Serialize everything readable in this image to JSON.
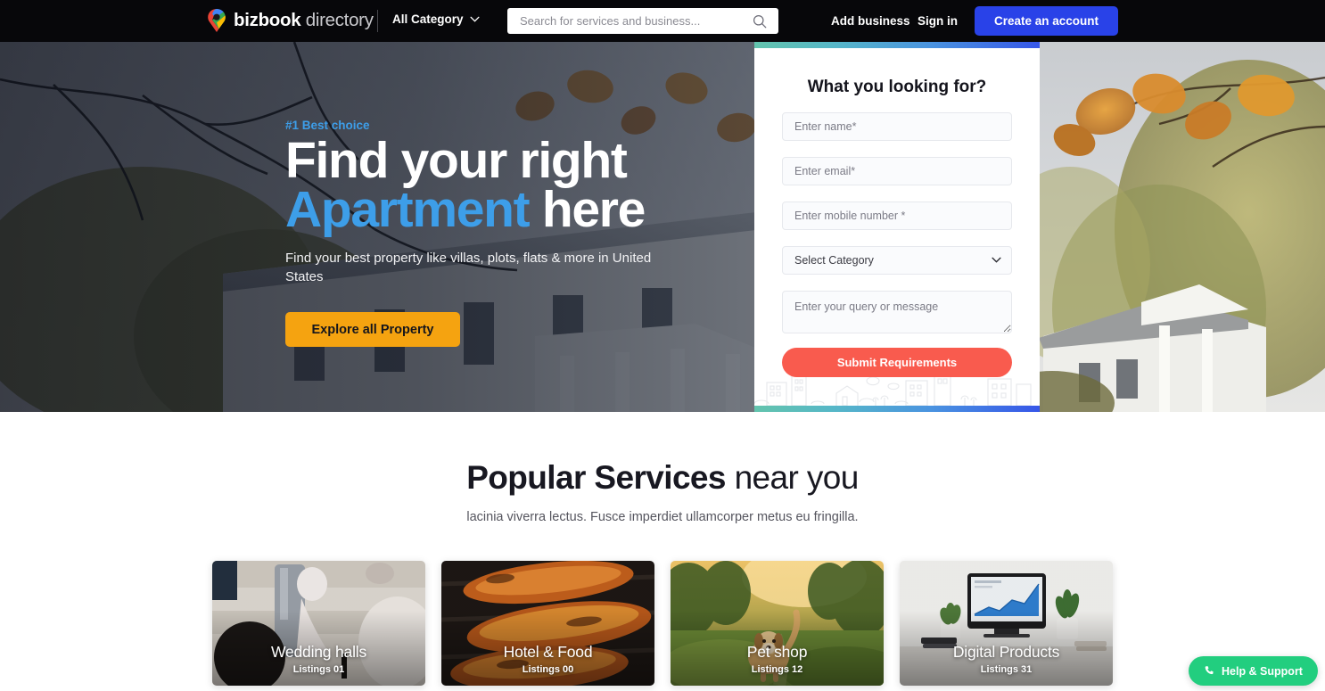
{
  "header": {
    "logo": {
      "brand": "bizbook",
      "suffix": "directory",
      "icon": "map-pin-icon"
    },
    "category_label": "All Category",
    "search": {
      "placeholder": "Search for services and business...",
      "value": "",
      "icon": "search-icon"
    },
    "add_business": "Add business",
    "sign_in": "Sign in",
    "create_account": "Create an account",
    "accent_button_color": "#2942e8",
    "background_color": "#07070a"
  },
  "hero": {
    "eyebrow": "#1 Best choice",
    "title_line1": "Find your right",
    "title_highlight": "Apartment",
    "title_line2_rest": " here",
    "subtitle": "Find your best property like villas, plots, flats & more in United States",
    "cta": "Explore all Property",
    "cta_color": "#f5a310",
    "highlight_color": "#3d9ee9"
  },
  "lead_form": {
    "title": "What you looking for?",
    "name_placeholder": "Enter name*",
    "email_placeholder": "Enter email*",
    "mobile_placeholder": "Enter mobile number *",
    "category_selected": "Select Category",
    "message_placeholder": "Enter your query or message",
    "submit_label": "Submit Requirements",
    "submit_color": "#f95b4e",
    "name_value": "",
    "email_value": "",
    "mobile_value": "",
    "message_value": "",
    "chevron_icon": "chevron-down-icon"
  },
  "services": {
    "title_bold": "Popular Services",
    "title_light": " near you",
    "subtitle": "lacinia viverra lectus. Fusce imperdiet ullamcorper metus eu fringilla.",
    "cards": [
      {
        "name": "Wedding halls",
        "listings": "Listings 01"
      },
      {
        "name": "Hotel & Food",
        "listings": "Listings 00"
      },
      {
        "name": "Pet shop",
        "listings": "Listings 12"
      },
      {
        "name": "Digital Products",
        "listings": "Listings 31"
      }
    ]
  },
  "help_fab": {
    "label": "Help & Support",
    "icon": "phone-icon",
    "color": "#22ce7f"
  }
}
